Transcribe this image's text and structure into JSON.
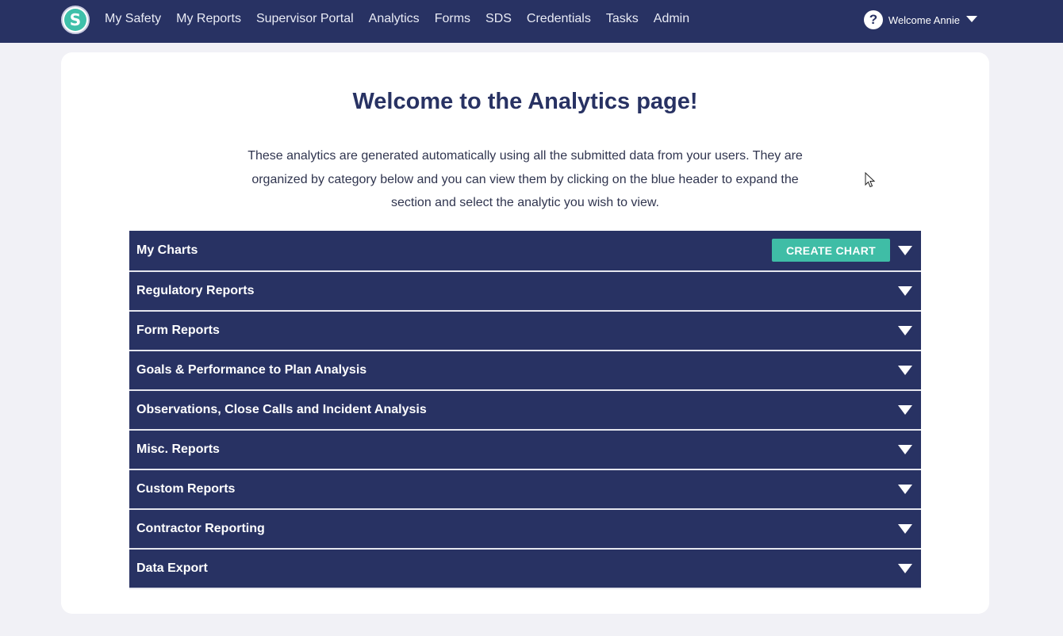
{
  "nav": {
    "logo_letter": "S",
    "items": [
      {
        "label": "My Safety"
      },
      {
        "label": "My Reports"
      },
      {
        "label": "Supervisor Portal"
      },
      {
        "label": "Analytics"
      },
      {
        "label": "Forms"
      },
      {
        "label": "SDS"
      },
      {
        "label": "Credentials"
      },
      {
        "label": "Tasks"
      },
      {
        "label": "Admin"
      }
    ],
    "help_glyph": "?",
    "welcome": "Welcome Annie"
  },
  "page": {
    "title": "Welcome to the Analytics page!",
    "intro": "These analytics are generated automatically using all the submitted data from your users. They are organized by category below and you can view them by clicking on the blue header to expand the section and select the analytic you wish to view."
  },
  "accordion": {
    "create_chart_label": "CREATE CHART",
    "sections": [
      {
        "label": "My Charts"
      },
      {
        "label": "Regulatory Reports"
      },
      {
        "label": "Form Reports"
      },
      {
        "label": "Goals & Performance to Plan Analysis"
      },
      {
        "label": "Observations, Close Calls and Incident Analysis"
      },
      {
        "label": "Misc. Reports"
      },
      {
        "label": "Custom Reports"
      },
      {
        "label": "Contractor Reporting"
      },
      {
        "label": "Data Export"
      }
    ]
  },
  "colors": {
    "nav_bg": "#283263",
    "accent": "#3fbda6",
    "page_bg": "#f1f1f6"
  }
}
